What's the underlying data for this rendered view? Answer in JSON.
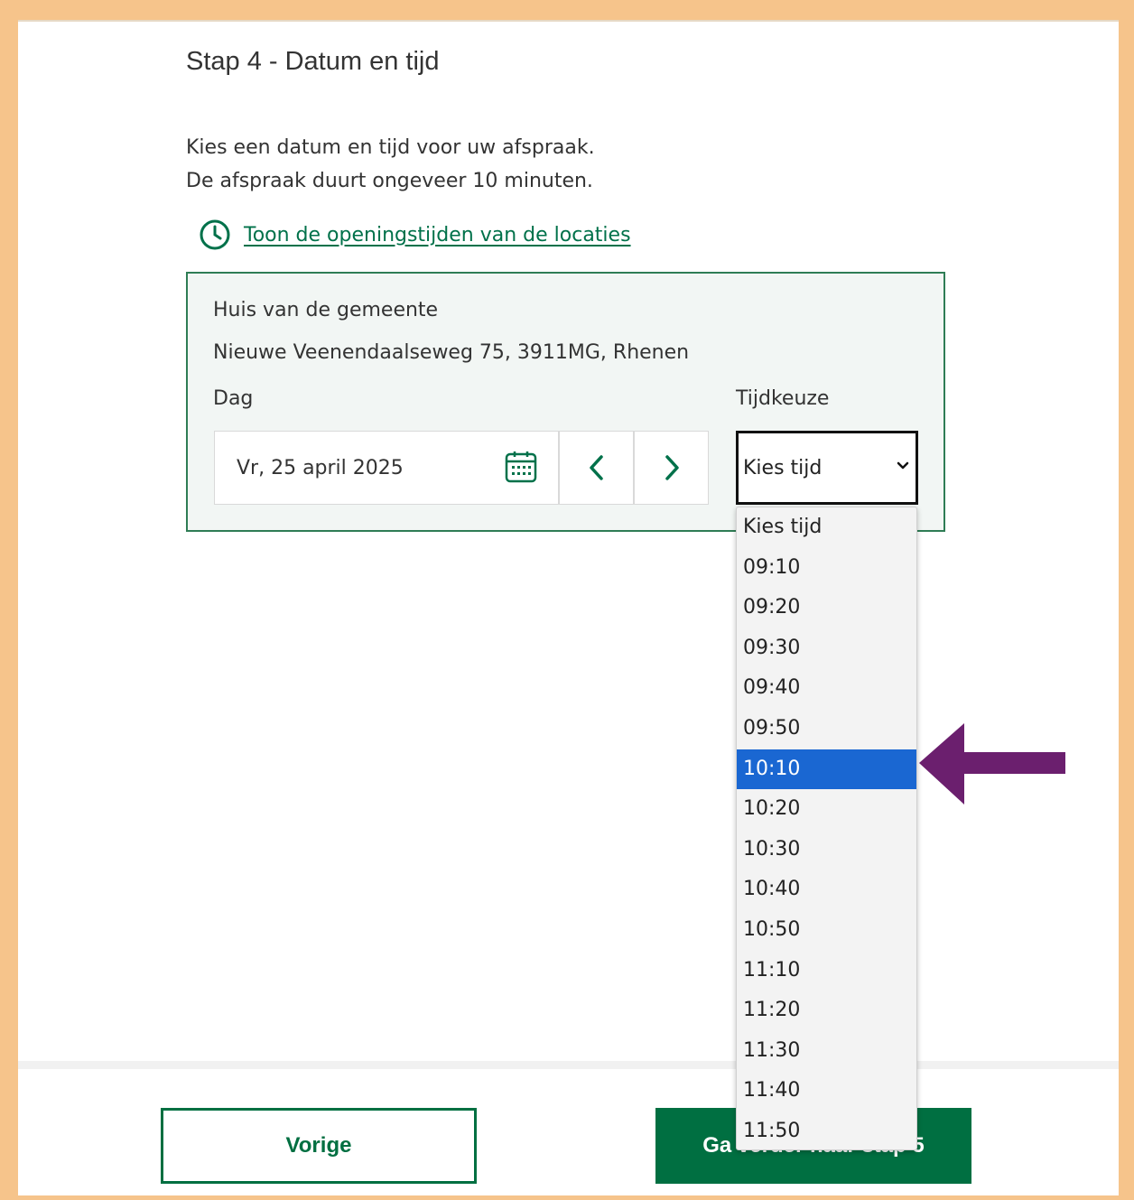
{
  "step": {
    "title": "Stap 4 - Datum en tijd"
  },
  "intro": {
    "line1": "Kies een datum en tijd voor uw afspraak.",
    "line2": "De afspraak duurt ongeveer 10 minuten."
  },
  "hours_link": {
    "icon": "clock-icon",
    "label": "Toon de openingstijden van de locaties"
  },
  "location": {
    "name": "Huis van de gemeente",
    "address": "Nieuwe Veenendaalseweg 75, 3911MG, Rhenen"
  },
  "day": {
    "label": "Dag",
    "value": "Vr, 25 april 2025",
    "calendar_icon": "calendar-icon",
    "prev_icon": "chevron-left-icon",
    "next_icon": "chevron-right-icon"
  },
  "time": {
    "label": "Tijdkeuze",
    "selected": "Kies tijd",
    "options": [
      "Kies tijd",
      "09:10",
      "09:20",
      "09:30",
      "09:40",
      "09:50",
      "10:10",
      "10:20",
      "10:30",
      "10:40",
      "10:50",
      "11:10",
      "11:20",
      "11:30",
      "11:40",
      "11:50"
    ],
    "highlighted": "10:10"
  },
  "buttons": {
    "previous": "Vorige",
    "next": "Ga verder naar stap 5"
  },
  "colors": {
    "accent": "#006f41",
    "highlight": "#1a67d2",
    "annotation_arrow": "#6b1f6e",
    "frame": "#f6c48b"
  }
}
